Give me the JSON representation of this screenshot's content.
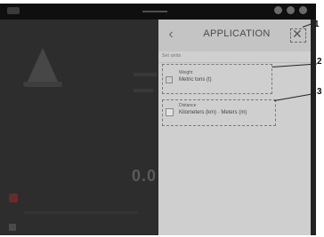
{
  "panel": {
    "title": "APPLICATION",
    "section_label": "Set units",
    "weight": {
      "title": "Weight",
      "value": "Metric tons (t)"
    },
    "distance": {
      "title": "Distance",
      "value": "Kilometers (km) · Meters (m)"
    }
  },
  "background": {
    "number": "0.0"
  },
  "callouts": [
    "1",
    "2",
    "3"
  ],
  "icons": {
    "back": "back-arrow-icon",
    "close": "close-icon"
  }
}
